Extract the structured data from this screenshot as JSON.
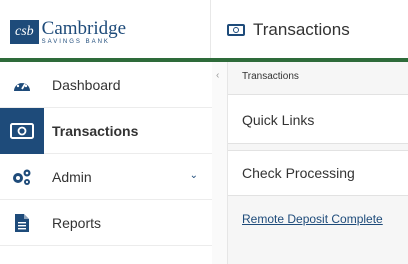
{
  "logo": {
    "badge": "csb",
    "name": "Cambridge",
    "sub": "SAVINGS BANK"
  },
  "header": {
    "title": "Transactions",
    "title_icon": "money-icon"
  },
  "sidebar": {
    "items": [
      {
        "label": "Dashboard",
        "icon": "speedometer-icon"
      },
      {
        "label": "Transactions",
        "icon": "money-icon",
        "active": true
      },
      {
        "label": "Admin",
        "icon": "gears-icon",
        "has_chevron": true
      },
      {
        "label": "Reports",
        "icon": "document-icon"
      }
    ],
    "collapse_glyph": "‹"
  },
  "main": {
    "breadcrumb": "Transactions",
    "panels": [
      {
        "title": "Quick Links"
      },
      {
        "title": "Check Processing"
      }
    ],
    "link": "Remote Deposit Complete"
  },
  "colors": {
    "brand": "#1e4b7a",
    "accent_line": "#2e6b3a"
  }
}
